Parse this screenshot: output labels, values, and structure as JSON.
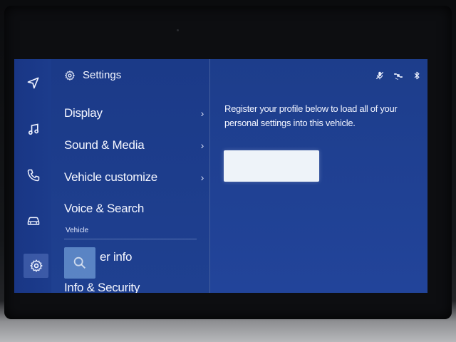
{
  "header": {
    "title": "Settings"
  },
  "rail": {
    "items": [
      {
        "icon": "navigation-icon"
      },
      {
        "icon": "music-icon"
      },
      {
        "icon": "phone-icon"
      },
      {
        "icon": "car-icon"
      },
      {
        "icon": "gear-icon",
        "active": true
      }
    ]
  },
  "menu": {
    "items": [
      {
        "label": "Display",
        "chevron": "›"
      },
      {
        "label": "Sound & Media",
        "chevron": "›"
      },
      {
        "label": "Vehicle customize",
        "chevron": "›"
      },
      {
        "label": "Voice & Search"
      }
    ],
    "section_label": "Vehicle",
    "partial_items": [
      {
        "label": "er info"
      },
      {
        "label": "Info & Security"
      }
    ]
  },
  "content": {
    "prompt": "Register your profile below to load all of your personal settings into this vehicle.",
    "button_label": ""
  },
  "status": {
    "icons": [
      "mic-off-icon",
      "satellite-icon",
      "bluetooth-icon"
    ]
  }
}
